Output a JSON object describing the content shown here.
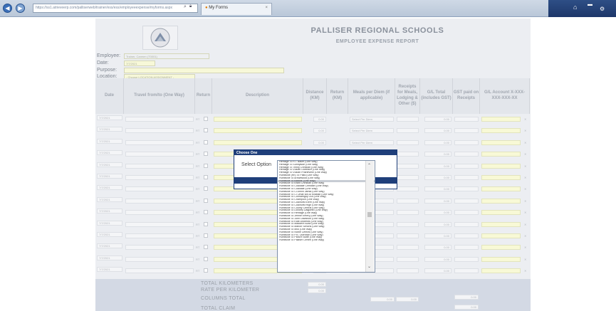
{
  "browser": {
    "address": "https://ss1.atrieveerp.com/palliserweb/trainer/ess/ess/employeeexpense/myforms.aspx",
    "tab_title": "My Forms",
    "tab_close": "×"
  },
  "header": {
    "title": "PALLISER REGIONAL SCHOOLS",
    "subtitle": "EMPLOYEE EXPENSE REPORT"
  },
  "info": {
    "employee_label": "Employee:",
    "employee_value": "Trainer, Carmen (T0001)",
    "date_label": "Date:",
    "date_value": "7/7/2021",
    "purpose_label": "Purpose:",
    "location_label": "Location:",
    "location_value": "- Choose LOCATION ASSIGNMENT -"
  },
  "table": {
    "headers": {
      "date": "Date",
      "travel": "Travel from/to (One Way)",
      "return": "Return",
      "description": "Description",
      "distance": "Distance (KM)",
      "return_km": "Return (KM)",
      "meals": "Meals per Diem (if applicable)",
      "receipts": "Receipts for Meals, Lodging & Other ($)",
      "gl_total": "G/L Total (includes GST)",
      "gst": "GST paid on Receipts",
      "gl_account": "G/L Account X-XXX-XXX-XXX-XX"
    },
    "row_date_placeholder": "7/7/2021",
    "row_rt": "RT",
    "row_distance": "0.00",
    "row_meals_placeholder": "Select Per Diem",
    "row_gl_total": "0.00"
  },
  "totals": {
    "total_km_label": "TOTAL KILOMETERS",
    "total_km_value": "0.00",
    "rate_label": "RATE PER KILOMETER",
    "rate_value": "0.00",
    "columns_total_label": "COLUMNS TOTAL",
    "columns_total_a": "0.00",
    "columns_total_b": "0.00",
    "columns_total_c": "0.00",
    "total_claim_label": "TOTAL CLAIM",
    "total_claim_value": "0.00"
  },
  "dialog": {
    "title": "Choose One",
    "select_label": "Select Option",
    "options": [
      "Heritage To R.I. Baker (One Way)",
      "Heritage To Sunnyside (One Way)",
      "Heritage To Trinity Christian (One Way)",
      "Heritage To Vulcan Outreach (One Way)",
      "Heritage To Vulcan Prairieview (One Way)",
      "Huntsville (Hn) To Pass (One Way)",
      "Huntsville To Arrowwood (One Way)",
      "Huntsville To Barons (One Way)",
      "Huntsville To Brant Christian (One Way)",
      "Huntsville To Coaldale Christian (One Way)",
      "Huntsville To Coaldale (One Way)",
      "Huntsville To Cl Ahnin Jamia (One Way)",
      "Huntsville To Cl Omar Bin Al Khattab (One Way)",
      "Huntsville To Connamgoy Out (One Way)",
      "Huntsville To Champion (One Way)",
      "Huntsville To Coalhurst Elem (One Way)",
      "Huntsville To Coalhurst High (One Way)",
      "Huntsville To County Central (One Way)",
      "Huntsville To Dorothy Dalgliesh (One Way)",
      "Huntsville To Heritage (One Way)",
      "Huntsville To Jennie Emery (One Way)",
      "Huntsville To John Davidson (One Way)",
      "Huntsville To Kate Andrews (One Way)",
      "Huntsville To Maddere Acad (One Way)",
      "Huntsville To Manoir Simons (One Way)",
      "Huntsville To Milo (One Way)",
      "Huntsville To Noble Central (One Way)",
      "Huntsville To P.B. Outreach (One Way)",
      "Huntsville To Picture Butte (One Way)",
      "Huntsville To Palliser Centre (One Way)"
    ],
    "selected_index": 7
  },
  "colors": {
    "dialog_blue": "#1f3f7a",
    "field_yellow": "#f7f8d8",
    "form_gray": "#eceef2"
  },
  "icons": [
    "back-icon",
    "forward-icon",
    "search-icon",
    "lock-icon",
    "refresh-icon",
    "star-icon",
    "gear-icon",
    "minimize-icon",
    "close-icon"
  ]
}
